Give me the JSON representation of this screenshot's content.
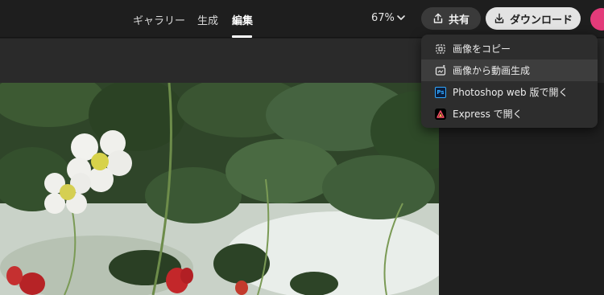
{
  "nav": {
    "tabs": [
      {
        "label": "ギャラリー",
        "active": false
      },
      {
        "label": "生成",
        "active": false
      },
      {
        "label": "編集",
        "active": true
      }
    ]
  },
  "zoom": {
    "value": "67%"
  },
  "actions": {
    "share_label": "共有",
    "download_label": "ダウンロード"
  },
  "menu": {
    "items": [
      {
        "label": "画像をコピー",
        "icon": "copy-image-icon"
      },
      {
        "label": "画像から動画生成",
        "icon": "image-to-video-icon",
        "highlighted": true
      },
      {
        "label": "Photoshop web 版で開く",
        "icon": "photoshop-icon"
      },
      {
        "label": "Express で開く",
        "icon": "adobe-express-icon"
      }
    ]
  },
  "colors": {
    "background": "#1e1e1e",
    "toolbar": "#2a2a2a",
    "menu": "#2d2d2d",
    "download_button": "#e3e3e3",
    "avatar": "#e33b7a"
  },
  "canvas": {
    "image": "strawberry-plant-photo"
  }
}
